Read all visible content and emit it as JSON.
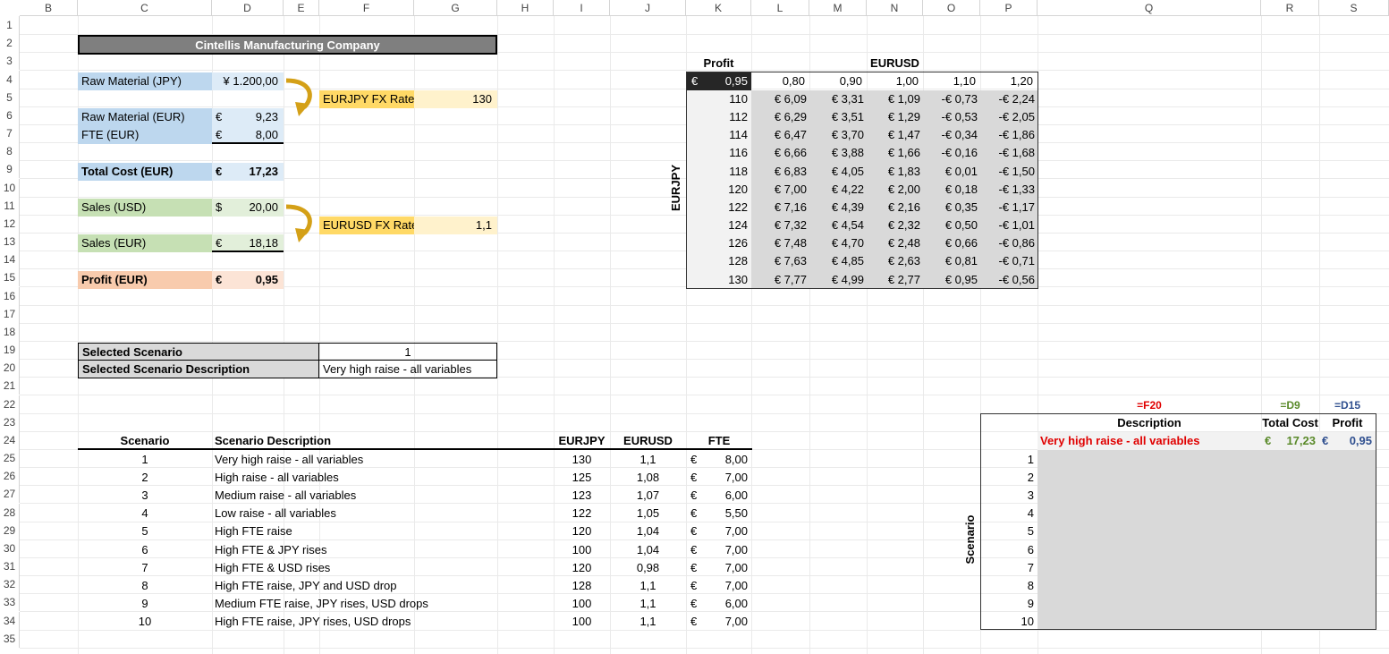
{
  "columns": [
    "B",
    "C",
    "D",
    "E",
    "F",
    "G",
    "H",
    "I",
    "J",
    "K",
    "L",
    "M",
    "N",
    "O",
    "P",
    "Q",
    "R",
    "S"
  ],
  "rows": [
    "1",
    "2",
    "3",
    "4",
    "5",
    "6",
    "7",
    "8",
    "9",
    "10",
    "11",
    "12",
    "13",
    "14",
    "15",
    "16",
    "17",
    "18",
    "19",
    "20",
    "21",
    "22",
    "23",
    "24",
    "25",
    "26",
    "27",
    "28",
    "29",
    "30",
    "31",
    "32",
    "33",
    "34",
    "35"
  ],
  "title": "Cintellis Manufacturing Company",
  "model": {
    "raw_jpy_label": "Raw Material (JPY)",
    "raw_jpy_value": "¥  1.200,00",
    "eurjpy_label": "EURJPY FX Rate",
    "eurjpy_value": "130",
    "raw_eur_label": "Raw Material (EUR)",
    "raw_eur_cur": "€",
    "raw_eur_value": "9,23",
    "fte_label": "FTE (EUR)",
    "fte_cur": "€",
    "fte_value": "8,00",
    "total_label": "Total Cost (EUR)",
    "total_cur": "€",
    "total_value": "17,23",
    "sales_usd_label": "Sales (USD)",
    "sales_usd_cur": "$",
    "sales_usd_value": "20,00",
    "eurusd_label": "EURUSD FX Rate",
    "eurusd_value": "1,1",
    "sales_eur_label": "Sales (EUR)",
    "sales_eur_cur": "€",
    "sales_eur_value": "18,18",
    "profit_label": "Profit (EUR)",
    "profit_cur": "€",
    "profit_value": "0,95"
  },
  "selected": {
    "scenario_label": "Selected Scenario",
    "scenario_value": "1",
    "desc_label": "Selected Scenario Description",
    "desc_value": "Very high raise - all variables"
  },
  "scenarios": {
    "headers": [
      "Scenario",
      "Scenario Description",
      "EURJPY",
      "EURUSD",
      "FTE"
    ],
    "rows": [
      [
        "1",
        "Very high raise - all variables",
        "130",
        "1,1",
        "€",
        "8,00"
      ],
      [
        "2",
        "High raise - all variables",
        "125",
        "1,08",
        "€",
        "7,00"
      ],
      [
        "3",
        "Medium raise - all variables",
        "123",
        "1,07",
        "€",
        "6,00"
      ],
      [
        "4",
        "Low raise - all variables",
        "122",
        "1,05",
        "€",
        "5,50"
      ],
      [
        "5",
        "High FTE raise",
        "120",
        "1,04",
        "€",
        "7,00"
      ],
      [
        "6",
        "High FTE & JPY rises",
        "100",
        "1,04",
        "€",
        "7,00"
      ],
      [
        "7",
        "High FTE & USD rises",
        "120",
        "0,98",
        "€",
        "7,00"
      ],
      [
        "8",
        "High FTE raise, JPY and USD drop",
        "128",
        "1,1",
        "€",
        "7,00"
      ],
      [
        "9",
        "Medium FTE raise, JPY rises, USD drops",
        "100",
        "1,1",
        "€",
        "6,00"
      ],
      [
        "10",
        "High FTE raise, JPY rises, USD drops",
        "100",
        "1,1",
        "€",
        "7,00"
      ]
    ]
  },
  "sens": {
    "profit_label": "Profit",
    "eurusd_label": "EURUSD",
    "eurjpy_label": "EURJPY",
    "corner_cur": "€",
    "corner_value": "0,95",
    "usd_values": [
      "0,80",
      "0,90",
      "1,00",
      "1,10",
      "1,20"
    ],
    "jpy_values": [
      "110",
      "112",
      "114",
      "116",
      "118",
      "120",
      "122",
      "124",
      "126",
      "128",
      "130"
    ],
    "matrix": [
      [
        "€ 6,09",
        "€ 3,31",
        "€ 1,09",
        "-€ 0,73",
        "-€ 2,24"
      ],
      [
        "€ 6,29",
        "€ 3,51",
        "€ 1,29",
        "-€ 0,53",
        "-€ 2,05"
      ],
      [
        "€ 6,47",
        "€ 3,70",
        "€ 1,47",
        "-€ 0,34",
        "-€ 1,86"
      ],
      [
        "€ 6,66",
        "€ 3,88",
        "€ 1,66",
        "-€ 0,16",
        "-€ 1,68"
      ],
      [
        "€ 6,83",
        "€ 4,05",
        "€ 1,83",
        "€ 0,01",
        "-€ 1,50"
      ],
      [
        "€ 7,00",
        "€ 4,22",
        "€ 2,00",
        "€ 0,18",
        "-€ 1,33"
      ],
      [
        "€ 7,16",
        "€ 4,39",
        "€ 2,16",
        "€ 0,35",
        "-€ 1,17"
      ],
      [
        "€ 7,32",
        "€ 4,54",
        "€ 2,32",
        "€ 0,50",
        "-€ 1,01"
      ],
      [
        "€ 7,48",
        "€ 4,70",
        "€ 2,48",
        "€ 0,66",
        "-€ 0,86"
      ],
      [
        "€ 7,63",
        "€ 4,85",
        "€ 2,63",
        "€ 0,81",
        "-€ 0,71"
      ],
      [
        "€ 7,77",
        "€ 4,99",
        "€ 2,77",
        "€ 0,95",
        "-€ 0,56"
      ]
    ]
  },
  "scen_table": {
    "f_desc": "=F20",
    "f_cost": "=D9",
    "f_profit": "=D15",
    "h_desc": "Description",
    "h_cost": "Total Cost",
    "h_profit": "Profit",
    "desc_value": "Very high raise - all variables",
    "cost_cur": "€",
    "cost_value": "17,23",
    "profit_cur": "€",
    "profit_value": "0,95",
    "axis_label": "Scenario",
    "numbers": [
      "1",
      "2",
      "3",
      "4",
      "5",
      "6",
      "7",
      "8",
      "9",
      "10"
    ]
  },
  "colors": {
    "desc_red": "#e00000",
    "cost_green": "#5a8a2a",
    "profit_blue": "#2f4f8f"
  }
}
